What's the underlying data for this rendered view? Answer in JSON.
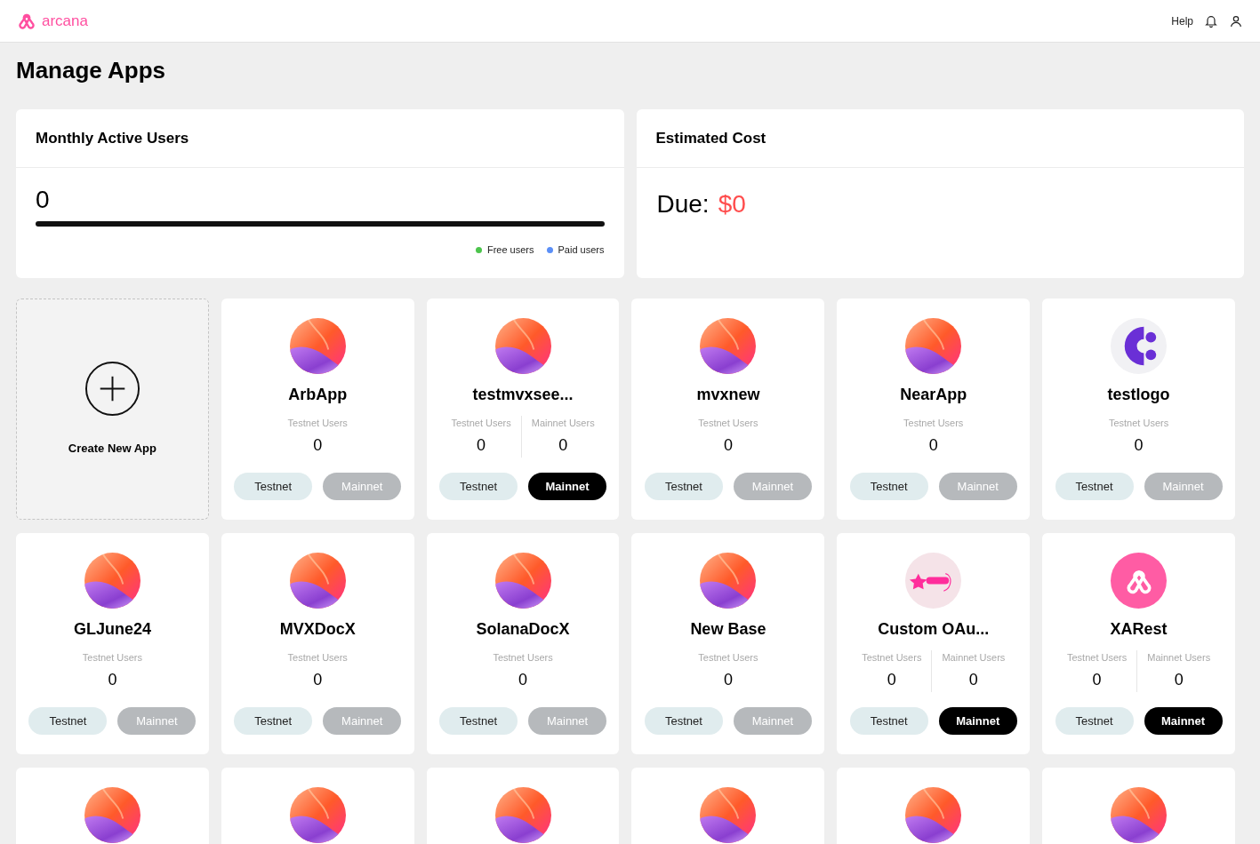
{
  "header": {
    "brand": "arcana",
    "links": [
      "Help"
    ]
  },
  "page_title": "Manage Apps",
  "mau": {
    "title": "Monthly Active Users",
    "value": "0",
    "legend": [
      {
        "label": "Free users",
        "color": "#4cc44c"
      },
      {
        "label": "Paid users",
        "color": "#5b8ff7"
      }
    ]
  },
  "cost": {
    "title": "Estimated Cost",
    "label": "Due:",
    "amount": "$0"
  },
  "create": {
    "label": "Create New App"
  },
  "apps": [
    {
      "name": "ArbApp",
      "kind": "gradient",
      "stats": [
        {
          "label": "Testnet Users",
          "value": "0"
        }
      ],
      "buttons": [
        {
          "label": "Testnet",
          "kind": "testnet",
          "enabled": true
        },
        {
          "label": "Mainnet",
          "kind": "mainnet",
          "enabled": false
        }
      ]
    },
    {
      "name": "testmvxsee...",
      "kind": "gradient",
      "stats": [
        {
          "label": "Testnet Users",
          "value": "0"
        },
        {
          "label": "Mainnet Users",
          "value": "0"
        }
      ],
      "buttons": [
        {
          "label": "Testnet",
          "kind": "testnet",
          "enabled": true
        },
        {
          "label": "Mainnet",
          "kind": "mainnet",
          "enabled": true
        }
      ]
    },
    {
      "name": "mvxnew",
      "kind": "gradient",
      "stats": [
        {
          "label": "Testnet Users",
          "value": "0"
        }
      ],
      "buttons": [
        {
          "label": "Testnet",
          "kind": "testnet",
          "enabled": true
        },
        {
          "label": "Mainnet",
          "kind": "mainnet",
          "enabled": false
        }
      ]
    },
    {
      "name": "NearApp",
      "kind": "gradient",
      "stats": [
        {
          "label": "Testnet Users",
          "value": "0"
        }
      ],
      "buttons": [
        {
          "label": "Testnet",
          "kind": "testnet",
          "enabled": true
        },
        {
          "label": "Mainnet",
          "kind": "mainnet",
          "enabled": false
        }
      ]
    },
    {
      "name": "testlogo",
      "kind": "letter",
      "stats": [
        {
          "label": "Testnet Users",
          "value": "0"
        }
      ],
      "buttons": [
        {
          "label": "Testnet",
          "kind": "testnet",
          "enabled": true
        },
        {
          "label": "Mainnet",
          "kind": "mainnet",
          "enabled": false
        }
      ]
    },
    {
      "name": "GLJune24",
      "kind": "gradient",
      "stats": [
        {
          "label": "Testnet Users",
          "value": "0"
        }
      ],
      "buttons": [
        {
          "label": "Testnet",
          "kind": "testnet",
          "enabled": true
        },
        {
          "label": "Mainnet",
          "kind": "mainnet",
          "enabled": false
        }
      ]
    },
    {
      "name": "MVXDocX",
      "kind": "gradient",
      "stats": [
        {
          "label": "Testnet Users",
          "value": "0"
        }
      ],
      "buttons": [
        {
          "label": "Testnet",
          "kind": "testnet",
          "enabled": true
        },
        {
          "label": "Mainnet",
          "kind": "mainnet",
          "enabled": false
        }
      ]
    },
    {
      "name": "SolanaDocX",
      "kind": "gradient",
      "stats": [
        {
          "label": "Testnet Users",
          "value": "0"
        }
      ],
      "buttons": [
        {
          "label": "Testnet",
          "kind": "testnet",
          "enabled": true
        },
        {
          "label": "Mainnet",
          "kind": "mainnet",
          "enabled": false
        }
      ]
    },
    {
      "name": "New Base",
      "kind": "gradient",
      "stats": [
        {
          "label": "Testnet Users",
          "value": "0"
        }
      ],
      "buttons": [
        {
          "label": "Testnet",
          "kind": "testnet",
          "enabled": true
        },
        {
          "label": "Mainnet",
          "kind": "mainnet",
          "enabled": false
        }
      ]
    },
    {
      "name": "Custom OAu...",
      "kind": "star",
      "stats": [
        {
          "label": "Testnet Users",
          "value": "0"
        },
        {
          "label": "Mainnet Users",
          "value": "0"
        }
      ],
      "buttons": [
        {
          "label": "Testnet",
          "kind": "testnet",
          "enabled": true
        },
        {
          "label": "Mainnet",
          "kind": "mainnet",
          "enabled": true
        }
      ]
    },
    {
      "name": "XARest",
      "kind": "arcana",
      "stats": [
        {
          "label": "Testnet Users",
          "value": "0"
        },
        {
          "label": "Mainnet Users",
          "value": "0"
        }
      ],
      "buttons": [
        {
          "label": "Testnet",
          "kind": "testnet",
          "enabled": true
        },
        {
          "label": "Mainnet",
          "kind": "mainnet",
          "enabled": true
        }
      ]
    },
    {
      "kind": "gradient"
    },
    {
      "kind": "gradient"
    },
    {
      "kind": "gradient"
    },
    {
      "kind": "gradient"
    },
    {
      "kind": "gradient"
    },
    {
      "kind": "gradient"
    }
  ]
}
